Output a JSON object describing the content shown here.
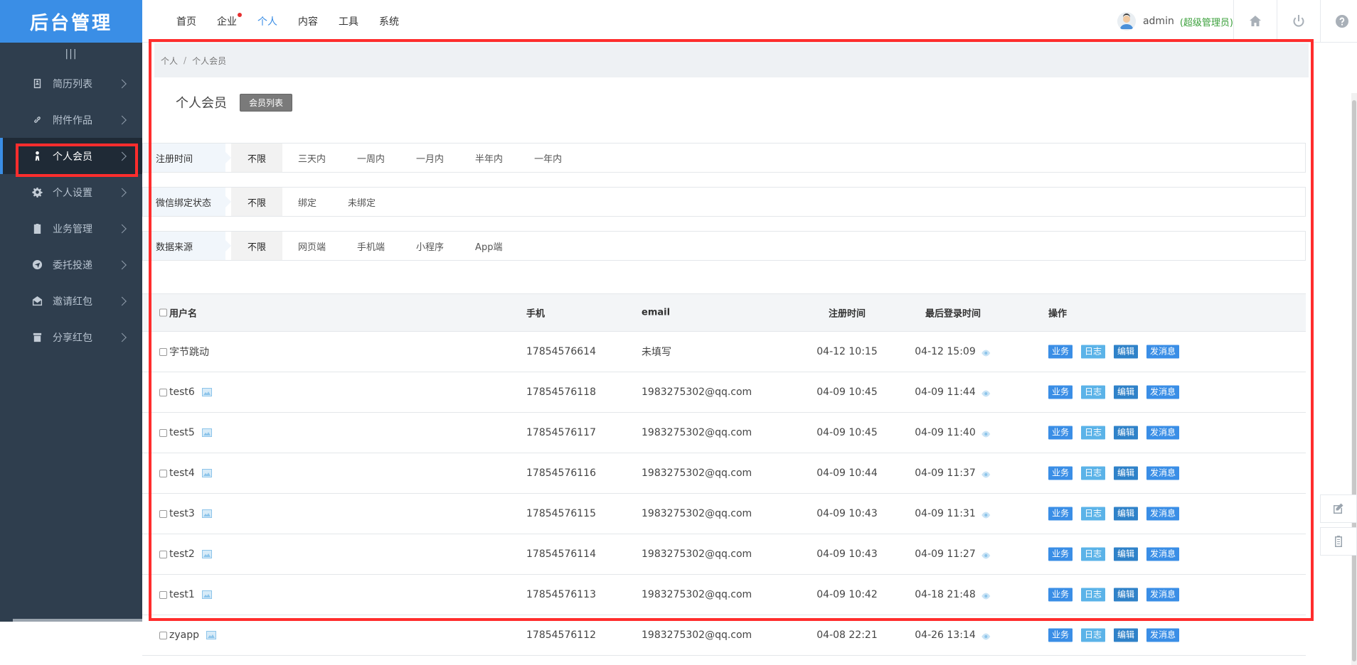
{
  "app": {
    "logo": "后台管理"
  },
  "sidebar": {
    "toggle": "|||",
    "items": [
      {
        "label": "简历列表",
        "icon": "resume-icon"
      },
      {
        "label": "附件作品",
        "icon": "link-icon"
      },
      {
        "label": "个人会员",
        "icon": "person-icon",
        "active": true
      },
      {
        "label": "个人设置",
        "icon": "gear-icon"
      },
      {
        "label": "业务管理",
        "icon": "clipboard-icon"
      },
      {
        "label": "委托投递",
        "icon": "send-icon"
      },
      {
        "label": "邀请红包",
        "icon": "envelope-icon"
      },
      {
        "label": "分享红包",
        "icon": "share-icon"
      }
    ]
  },
  "topnav": {
    "items": [
      {
        "label": "首页"
      },
      {
        "label": "企业",
        "badge": true
      },
      {
        "label": "个人",
        "active": true
      },
      {
        "label": "内容"
      },
      {
        "label": "工具"
      },
      {
        "label": "系统"
      }
    ]
  },
  "user": {
    "name": "admin",
    "role": "(超级管理员)"
  },
  "breadcrumb": {
    "parent": "个人",
    "sep": "/",
    "current": "个人会员"
  },
  "page": {
    "title": "个人会员",
    "tag": "会员列表"
  },
  "filters": [
    {
      "label": "注册时间",
      "options": [
        "不限",
        "三天内",
        "一周内",
        "一月内",
        "半年内",
        "一年内"
      ],
      "selected": 0
    },
    {
      "label": "微信绑定状态",
      "options": [
        "不限",
        "绑定",
        "未绑定"
      ],
      "selected": 0
    },
    {
      "label": "数据来源",
      "options": [
        "不限",
        "网页端",
        "手机端",
        "小程序",
        "App端"
      ],
      "selected": 0
    }
  ],
  "table": {
    "headers": {
      "user": "用户名",
      "phone": "手机",
      "email": "email",
      "reg": "注册时间",
      "last": "最后登录时间",
      "ops": "操作"
    },
    "op_labels": {
      "biz": "业务",
      "log": "日志",
      "edit": "编辑",
      "msg": "发消息"
    },
    "rows": [
      {
        "user": "字节跳动",
        "has_img": false,
        "phone": "17854576614",
        "email": "未填写",
        "reg": "04-12 10:15",
        "last": "04-12 15:09"
      },
      {
        "user": "test6",
        "has_img": true,
        "phone": "17854576118",
        "email": "1983275302@qq.com",
        "reg": "04-09 10:45",
        "last": "04-09 11:44"
      },
      {
        "user": "test5",
        "has_img": true,
        "phone": "17854576117",
        "email": "1983275302@qq.com",
        "reg": "04-09 10:45",
        "last": "04-09 11:40"
      },
      {
        "user": "test4",
        "has_img": true,
        "phone": "17854576116",
        "email": "1983275302@qq.com",
        "reg": "04-09 10:44",
        "last": "04-09 11:37"
      },
      {
        "user": "test3",
        "has_img": true,
        "phone": "17854576115",
        "email": "1983275302@qq.com",
        "reg": "04-09 10:43",
        "last": "04-09 11:31"
      },
      {
        "user": "test2",
        "has_img": true,
        "phone": "17854576114",
        "email": "1983275302@qq.com",
        "reg": "04-09 10:43",
        "last": "04-09 11:27"
      },
      {
        "user": "test1",
        "has_img": true,
        "phone": "17854576113",
        "email": "1983275302@qq.com",
        "reg": "04-09 10:42",
        "last": "04-18 21:48"
      },
      {
        "user": "zyapp",
        "has_img": true,
        "phone": "17854576112",
        "email": "1983275302@qq.com",
        "reg": "04-08 22:21",
        "last": "04-26 13:14"
      }
    ]
  },
  "colors": {
    "accent": "#3a8ee6",
    "sidebar_bg": "#2f3e4e",
    "highlight": "#ff2d2d",
    "role_green": "#3ba03b"
  }
}
